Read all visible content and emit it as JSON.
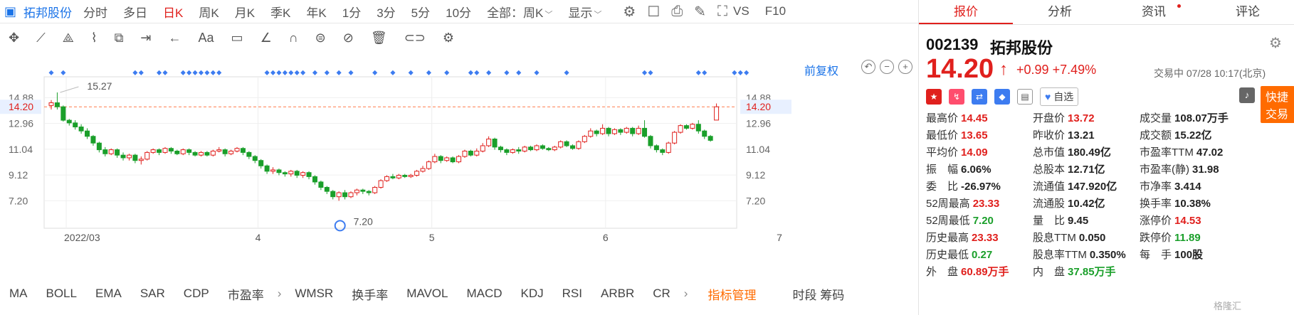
{
  "header": {
    "logo_icon": "chart-logo-icon",
    "stock_name": "拓邦股份",
    "period_tabs": [
      {
        "label": "分时"
      },
      {
        "label": "多日"
      },
      {
        "label": "日K",
        "active": true
      },
      {
        "label": "周K"
      },
      {
        "label": "月K"
      },
      {
        "label": "季K"
      },
      {
        "label": "年K"
      },
      {
        "label": "1分"
      },
      {
        "label": "3分"
      },
      {
        "label": "5分"
      },
      {
        "label": "10分"
      }
    ],
    "all_select": "全部：周K",
    "display_label": "显示",
    "vs_label": "VS",
    "f10_label": "F10"
  },
  "chart": {
    "fuquan_label": "前复权",
    "max_label": "15.27",
    "min_label": "7.20",
    "current_price_label": "14.20",
    "date_labels": [
      "2022/03",
      "4",
      "5",
      "6",
      "7"
    ]
  },
  "chart_data": {
    "type": "candlestick",
    "y_ticks": [
      "14.88",
      "12.96",
      "11.04",
      "9.12",
      "7.20"
    ],
    "y_range": [
      6.0,
      15.8
    ],
    "current_price": 14.2,
    "high_label": 15.27,
    "low_label": 7.2,
    "x_labels": [
      "2022/03",
      "4",
      "5",
      "6",
      "7"
    ],
    "candles": [
      [
        14.3,
        14.5,
        14.0,
        14.7
      ],
      [
        14.5,
        14.2,
        14.0,
        15.27
      ],
      [
        14.2,
        13.2,
        13.1,
        14.3
      ],
      [
        13.2,
        13.0,
        12.8,
        13.3
      ],
      [
        13.0,
        12.7,
        12.5,
        13.2
      ],
      [
        12.7,
        12.4,
        12.2,
        12.9
      ],
      [
        12.4,
        12.0,
        11.8,
        12.6
      ],
      [
        12.0,
        11.5,
        11.3,
        12.1
      ],
      [
        11.5,
        11.0,
        10.8,
        11.6
      ],
      [
        11.0,
        10.7,
        10.5,
        11.2
      ],
      [
        10.7,
        11.0,
        10.6,
        11.1
      ],
      [
        11.0,
        10.6,
        10.4,
        11.1
      ],
      [
        10.6,
        10.4,
        10.2,
        10.8
      ],
      [
        10.4,
        10.6,
        10.2,
        10.7
      ],
      [
        10.6,
        10.2,
        10.0,
        10.7
      ],
      [
        10.2,
        10.3,
        9.9,
        10.5
      ],
      [
        10.3,
        10.8,
        10.2,
        10.9
      ],
      [
        10.8,
        11.0,
        10.7,
        11.1
      ],
      [
        11.0,
        10.8,
        10.6,
        11.1
      ],
      [
        10.8,
        11.1,
        10.7,
        11.2
      ],
      [
        11.1,
        10.9,
        10.7,
        11.2
      ],
      [
        10.9,
        10.7,
        10.6,
        11.0
      ],
      [
        10.7,
        11.0,
        10.6,
        11.1
      ],
      [
        11.0,
        10.8,
        10.6,
        11.1
      ],
      [
        10.8,
        10.6,
        10.5,
        10.9
      ],
      [
        10.6,
        10.8,
        10.5,
        10.9
      ],
      [
        10.8,
        10.6,
        10.5,
        10.9
      ],
      [
        10.6,
        10.9,
        10.5,
        11.0
      ],
      [
        10.9,
        11.0,
        10.8,
        11.2
      ],
      [
        11.0,
        10.7,
        10.5,
        11.1
      ],
      [
        10.7,
        10.9,
        10.6,
        11.0
      ],
      [
        10.9,
        11.1,
        10.8,
        11.2
      ],
      [
        11.1,
        10.8,
        10.6,
        11.2
      ],
      [
        10.8,
        10.5,
        10.3,
        10.9
      ],
      [
        10.5,
        10.2,
        10.0,
        10.6
      ],
      [
        10.2,
        9.8,
        9.6,
        10.3
      ],
      [
        9.8,
        9.4,
        9.2,
        9.9
      ],
      [
        9.4,
        9.5,
        9.2,
        9.7
      ],
      [
        9.5,
        9.3,
        9.1,
        9.6
      ],
      [
        9.3,
        9.2,
        9.0,
        9.4
      ],
      [
        9.2,
        9.4,
        9.0,
        9.5
      ],
      [
        9.4,
        9.1,
        8.9,
        9.5
      ],
      [
        9.1,
        9.3,
        8.9,
        9.4
      ],
      [
        9.3,
        9.0,
        8.8,
        9.4
      ],
      [
        9.0,
        8.6,
        8.4,
        9.1
      ],
      [
        8.6,
        8.2,
        8.0,
        8.7
      ],
      [
        8.2,
        7.9,
        7.7,
        8.3
      ],
      [
        7.9,
        7.5,
        7.3,
        8.0
      ],
      [
        7.5,
        7.8,
        7.2,
        7.9
      ],
      [
        7.8,
        7.5,
        7.3,
        8.0
      ],
      [
        7.5,
        7.8,
        7.4,
        7.9
      ],
      [
        7.8,
        8.0,
        7.6,
        8.1
      ],
      [
        8.0,
        7.9,
        7.7,
        8.1
      ],
      [
        7.9,
        7.8,
        7.6,
        8.0
      ],
      [
        7.8,
        8.2,
        7.7,
        8.3
      ],
      [
        8.2,
        8.7,
        8.1,
        8.8
      ],
      [
        8.7,
        9.0,
        8.6,
        9.1
      ],
      [
        9.0,
        8.9,
        8.8,
        9.2
      ],
      [
        8.9,
        9.1,
        8.8,
        9.2
      ],
      [
        9.1,
        9.0,
        8.9,
        9.2
      ],
      [
        9.0,
        9.1,
        8.9,
        9.2
      ],
      [
        9.1,
        9.4,
        9.0,
        9.5
      ],
      [
        9.4,
        9.6,
        9.3,
        9.8
      ],
      [
        9.6,
        10.1,
        9.5,
        10.2
      ],
      [
        10.1,
        10.5,
        10.0,
        10.7
      ],
      [
        10.5,
        10.2,
        10.0,
        10.6
      ],
      [
        10.2,
        10.4,
        10.1,
        10.5
      ],
      [
        10.4,
        10.1,
        10.0,
        10.5
      ],
      [
        10.1,
        10.5,
        10.0,
        10.6
      ],
      [
        10.5,
        10.9,
        10.4,
        11.0
      ],
      [
        10.9,
        10.6,
        10.5,
        11.0
      ],
      [
        10.6,
        10.9,
        10.5,
        11.1
      ],
      [
        10.9,
        11.3,
        10.8,
        11.5
      ],
      [
        11.3,
        11.8,
        11.2,
        12.0
      ],
      [
        11.8,
        11.2,
        11.0,
        11.9
      ],
      [
        11.2,
        11.0,
        10.8,
        11.3
      ],
      [
        11.0,
        10.8,
        10.6,
        11.1
      ],
      [
        10.8,
        11.0,
        10.7,
        11.1
      ],
      [
        11.0,
        10.9,
        10.7,
        11.2
      ],
      [
        10.9,
        11.2,
        10.8,
        11.3
      ],
      [
        11.2,
        11.0,
        10.9,
        11.3
      ],
      [
        11.0,
        11.3,
        10.9,
        11.4
      ],
      [
        11.3,
        11.1,
        11.0,
        11.4
      ],
      [
        11.1,
        11.0,
        10.9,
        11.2
      ],
      [
        11.0,
        11.2,
        10.9,
        11.3
      ],
      [
        11.2,
        11.6,
        11.1,
        11.7
      ],
      [
        11.6,
        11.3,
        11.2,
        11.7
      ],
      [
        11.3,
        11.1,
        11.0,
        11.4
      ],
      [
        11.1,
        11.6,
        11.0,
        11.7
      ],
      [
        11.6,
        12.0,
        11.5,
        12.1
      ],
      [
        12.0,
        12.4,
        11.9,
        12.6
      ],
      [
        12.4,
        12.2,
        12.0,
        12.5
      ],
      [
        12.2,
        12.6,
        12.1,
        12.9
      ],
      [
        12.6,
        12.2,
        12.0,
        12.7
      ],
      [
        12.2,
        12.5,
        12.1,
        12.6
      ],
      [
        12.5,
        12.3,
        12.1,
        12.6
      ],
      [
        12.3,
        12.6,
        12.2,
        12.7
      ],
      [
        12.6,
        12.2,
        12.0,
        12.7
      ],
      [
        12.2,
        12.6,
        12.1,
        12.8
      ],
      [
        12.6,
        12.0,
        11.9,
        13.2
      ],
      [
        12.0,
        11.3,
        11.1,
        12.1
      ],
      [
        11.3,
        11.0,
        10.8,
        11.4
      ],
      [
        11.0,
        10.8,
        10.6,
        11.1
      ],
      [
        10.8,
        11.5,
        10.7,
        11.6
      ],
      [
        11.5,
        12.3,
        11.4,
        12.4
      ],
      [
        12.3,
        12.8,
        12.2,
        12.9
      ],
      [
        12.8,
        12.6,
        12.5,
        12.9
      ],
      [
        12.6,
        12.9,
        12.5,
        13.0
      ],
      [
        12.9,
        12.4,
        12.2,
        13.2
      ],
      [
        12.4,
        12.0,
        11.8,
        12.5
      ],
      [
        12.0,
        11.7,
        11.6,
        12.1
      ],
      [
        13.21,
        14.2,
        13.65,
        14.45
      ]
    ]
  },
  "indicators": [
    "MA",
    "BOLL",
    "EMA",
    "SAR",
    "CDP",
    "市盈率",
    "WMSR",
    "换手率",
    "MAVOL",
    "MACD",
    "KDJ",
    "RSI",
    "ARBR",
    "CR"
  ],
  "indicator_manage": "指标管理",
  "time_share_label": "时段 筹码",
  "right_tabs": [
    {
      "label": "报价",
      "active": true
    },
    {
      "label": "分析"
    },
    {
      "label": "资讯",
      "dot": true
    },
    {
      "label": "评论"
    }
  ],
  "quote": {
    "code": "002139",
    "name": "拓邦股份",
    "price": "14.20",
    "change": "+0.99",
    "change_pct": "+7.49%",
    "status": "交易中 07/28 10:17(北京)",
    "zixuan_label": "自选",
    "quick_trade": "快捷交易",
    "rows": [
      [
        {
          "lab": "最高价",
          "val": "14.45",
          "c": "red"
        },
        {
          "lab": "开盘价",
          "val": "13.72",
          "c": "red"
        },
        {
          "lab": "成交量",
          "val": "108.07万手",
          "c": "dark"
        }
      ],
      [
        {
          "lab": "最低价",
          "val": "13.65",
          "c": "red"
        },
        {
          "lab": "昨收价",
          "val": "13.21",
          "c": "dark"
        },
        {
          "lab": "成交额",
          "val": "15.22亿",
          "c": "dark"
        }
      ],
      [
        {
          "lab": "平均价",
          "val": "14.09",
          "c": "red"
        },
        {
          "lab": "总市值",
          "val": "180.49亿",
          "c": "dark"
        },
        {
          "lab": "市盈率TTM",
          "val": "47.02",
          "c": "dark"
        }
      ],
      [
        {
          "lab": "振　幅",
          "val": "6.06%",
          "c": "dark"
        },
        {
          "lab": "总股本",
          "val": "12.71亿",
          "c": "dark"
        },
        {
          "lab": "市盈率(静)",
          "val": "31.98",
          "c": "dark"
        }
      ],
      [
        {
          "lab": "委　比",
          "val": "-26.97%",
          "c": "dark"
        },
        {
          "lab": "流通值",
          "val": "147.920亿",
          "c": "dark"
        },
        {
          "lab": "市净率",
          "val": "3.414",
          "c": "dark"
        }
      ],
      [
        {
          "lab": "52周最高",
          "val": "23.33",
          "c": "red"
        },
        {
          "lab": "流通股",
          "val": "10.42亿",
          "c": "dark"
        },
        {
          "lab": "换手率",
          "val": "10.38%",
          "c": "dark"
        }
      ],
      [
        {
          "lab": "52周最低",
          "val": "7.20",
          "c": "green"
        },
        {
          "lab": "量　比",
          "val": "9.45",
          "c": "dark"
        },
        {
          "lab": "涨停价",
          "val": "14.53",
          "c": "red"
        }
      ],
      [
        {
          "lab": "历史最高",
          "val": "23.33",
          "c": "red"
        },
        {
          "lab": "股息TTM",
          "val": "0.050",
          "c": "dark"
        },
        {
          "lab": "跌停价",
          "val": "11.89",
          "c": "green"
        }
      ],
      [
        {
          "lab": "历史最低",
          "val": "0.27",
          "c": "green"
        },
        {
          "lab": "股息率TTM",
          "val": "0.350%",
          "c": "dark"
        },
        {
          "lab": "每　手",
          "val": "100股",
          "c": "dark"
        }
      ],
      [
        {
          "lab": "外　盘",
          "val": "60.89万手",
          "c": "red"
        },
        {
          "lab": "内　盘",
          "val": "37.85万手",
          "c": "green"
        },
        {
          "lab": "",
          "val": "",
          "c": "dark"
        }
      ]
    ]
  },
  "watermark": "格隆汇",
  "colors": {
    "up": "#e0201d",
    "down": "#1a9f2a",
    "accent": "#1a73e8",
    "orange": "#ff6b00"
  }
}
